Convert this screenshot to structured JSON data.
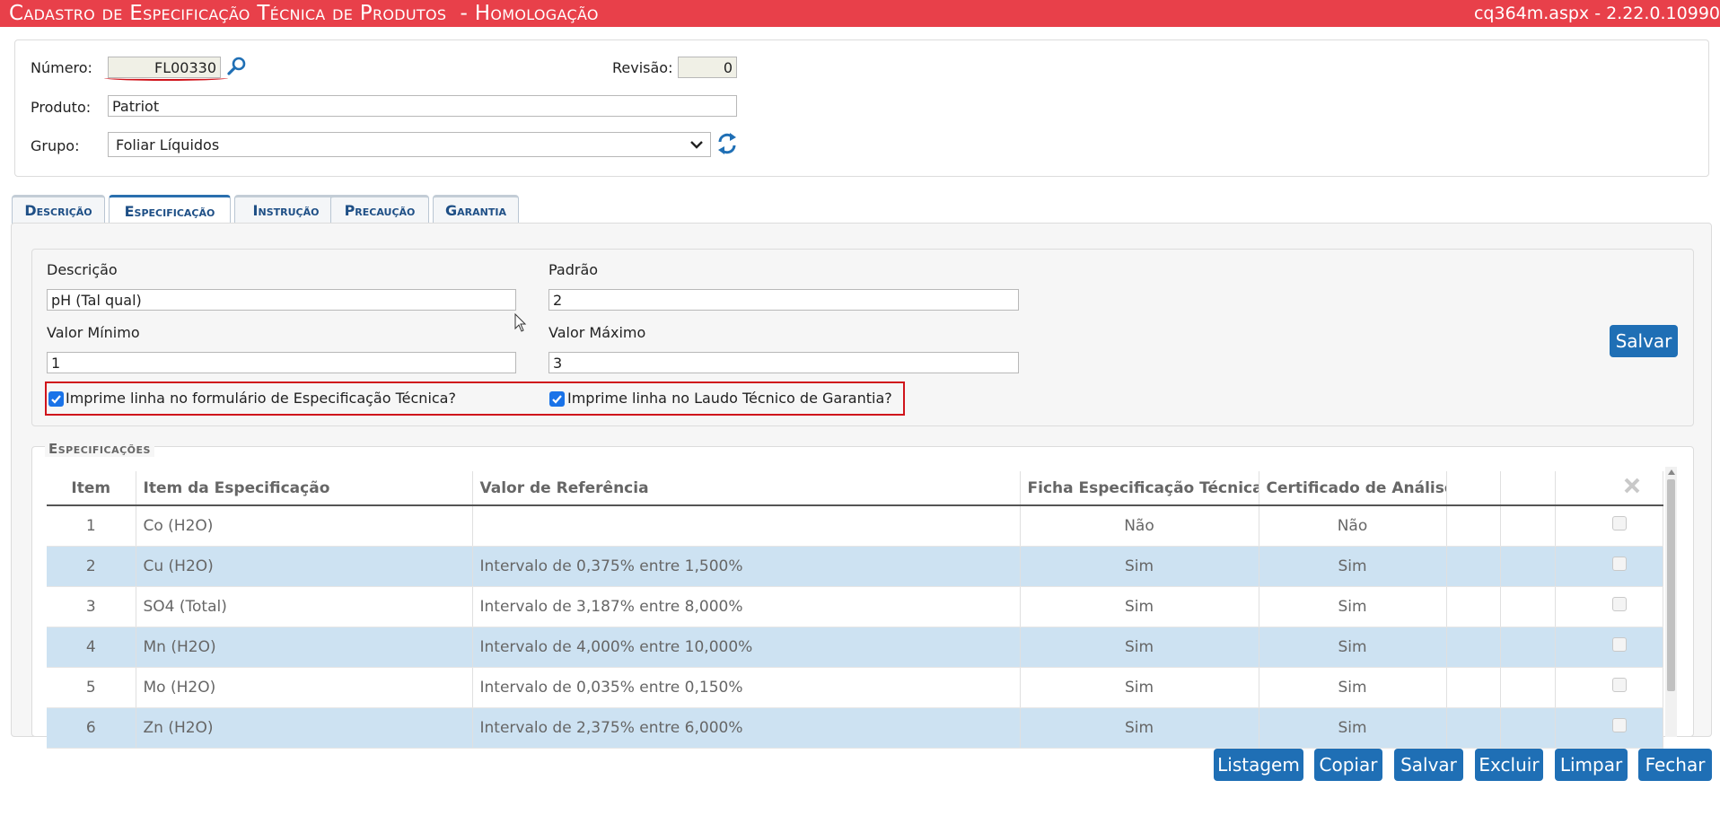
{
  "window": {
    "title": "Cadastro de Especificação Técnica de Produtos  - Homologação",
    "version": "cq364m.aspx - 2.22.0.10990"
  },
  "header": {
    "numero_label": "Número:",
    "numero_value": "FL00330",
    "revisao_label": "Revisão:",
    "revisao_value": "0",
    "produto_label": "Produto:",
    "produto_value": "Patriot",
    "grupo_label": "Grupo:",
    "grupo_value": "Foliar Líquidos"
  },
  "tabs": [
    {
      "label": "Descrição"
    },
    {
      "label": "Especificação"
    },
    {
      "label": "Instrução"
    },
    {
      "label": "Precaução"
    },
    {
      "label": "Garantia"
    }
  ],
  "form": {
    "descricao_label": "Descrição",
    "descricao_value": "pH (Tal qual)",
    "padrao_label": "Padrão",
    "padrao_value": "2",
    "valor_minimo_label": "Valor Mínimo",
    "valor_minimo_value": "1",
    "valor_maximo_label": "Valor Máximo",
    "valor_maximo_value": "3",
    "check1_label": "Imprime linha no formulário de Especificação Técnica?",
    "check1_checked": true,
    "check2_label": "Imprime linha no Laudo Técnico de Garantia?",
    "check2_checked": true,
    "save_label": "Salvar"
  },
  "grid": {
    "legend": "Especificações",
    "columns": [
      "Item",
      "Item da Especificação",
      "Valor de Referência",
      "Ficha Especificação Técnica",
      "Certificado de Análise",
      "",
      "",
      ""
    ],
    "rows": [
      {
        "item": "1",
        "spec": "Co (H2O)",
        "ref": "",
        "ficha": "Não",
        "cert": "Não"
      },
      {
        "item": "2",
        "spec": "Cu (H2O)",
        "ref": "Intervalo de 0,375% entre 1,500%",
        "ficha": "Sim",
        "cert": "Sim"
      },
      {
        "item": "3",
        "spec": "SO4 (Total)",
        "ref": "Intervalo de 3,187% entre 8,000%",
        "ficha": "Sim",
        "cert": "Sim"
      },
      {
        "item": "4",
        "spec": "Mn (H2O)",
        "ref": "Intervalo de 4,000% entre 10,000%",
        "ficha": "Sim",
        "cert": "Sim"
      },
      {
        "item": "5",
        "spec": "Mo (H2O)",
        "ref": "Intervalo de 0,035% entre 0,150%",
        "ficha": "Sim",
        "cert": "Sim"
      },
      {
        "item": "6",
        "spec": "Zn (H2O)",
        "ref": "Intervalo de 2,375% entre 6,000%",
        "ficha": "Sim",
        "cert": "Sim"
      }
    ]
  },
  "footer_buttons": {
    "listagem": "Listagem",
    "copiar": "Copiar",
    "salvar": "Salvar",
    "excluir": "Excluir",
    "limpar": "Limpar",
    "fechar": "Fechar"
  },
  "colors": {
    "title_bar": "#e8404a",
    "button": "#1f6fb5",
    "tab_text": "#1e4f86",
    "row_alt": "#cde2f2",
    "highlight": "#d0141b"
  },
  "icons": [
    "search-icon",
    "refresh-icon",
    "chevron-down-icon",
    "delete-x-icon",
    "checkbox-icon"
  ]
}
